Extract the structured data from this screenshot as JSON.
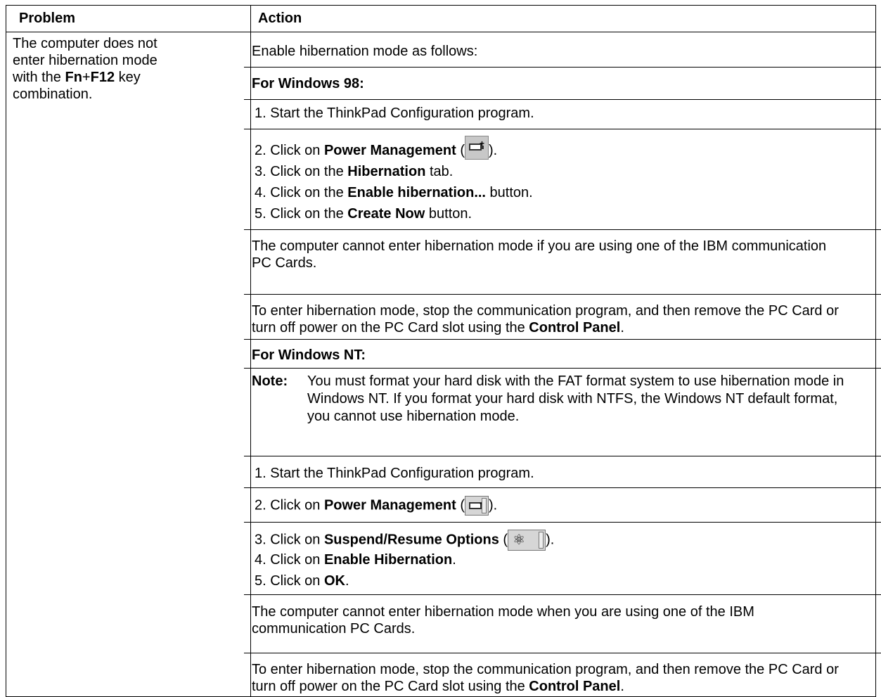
{
  "header": {
    "problem": "Problem",
    "action": "Action"
  },
  "problem": {
    "line1": "The computer does not",
    "line2": "enter hibernation mode",
    "line3_pre": "with the ",
    "key_fn": "Fn",
    "key_plus": "+",
    "key_f12": "F12",
    "line3_post": " key",
    "line4": "combination."
  },
  "action": {
    "intro": "Enable hibernation mode as follows:",
    "w98": {
      "heading": "For Windows 98:",
      "s1": "1. Start the ThinkPad Configuration program.",
      "s2_pre": "2. Click on ",
      "s2_bold": "Power Management",
      "s2_post_open": " (",
      "s2_post_close": ").",
      "s3_pre": "3. Click on the ",
      "s3_bold": "Hibernation",
      "s3_post": " tab.",
      "s4_pre": "4. Click on the ",
      "s4_bold": "Enable hibernation...",
      "s4_post": " button.",
      "s5_pre": "5. Click on the ",
      "s5_bold": "Create Now",
      "s5_post": " button.",
      "para1": "The computer cannot enter hibernation mode if you are using one of the IBM communication PC Cards.",
      "para2_pre": "To enter hibernation mode, stop the communication program, and then remove the PC Card or turn off power on the PC Card slot using the ",
      "para2_bold": "Control Panel",
      "para2_post": "."
    },
    "nt": {
      "heading": "For Windows NT:",
      "note_label": "Note:",
      "note_text": "You must format your hard disk with the FAT format system to use hibernation mode in Windows NT.  If you format your hard disk with NTFS, the Windows NT default format, you cannot use hibernation mode.",
      "s1": "1. Start the ThinkPad Configuration program.",
      "s2_pre": "2. Click on ",
      "s2_bold": "Power Management",
      "s2_post_open": " (",
      "s2_post_close": ").",
      "s3_pre": "3. Click on ",
      "s3_bold": "Suspend/Resume Options",
      "s3_post_open": " (",
      "s3_post_close": ").",
      "s4_pre": "4. Click on ",
      "s4_bold": "Enable Hibernation",
      "s4_post": ".",
      "s5_pre": "5. Click on ",
      "s5_bold": "OK",
      "s5_post": ".",
      "para1": "The computer cannot enter hibernation mode when you are using one of the IBM communication PC Cards.",
      "para2_pre": "To enter hibernation mode, stop the communication program, and then remove the PC Card or turn off power on the PC Card slot using the ",
      "para2_bold": "Control Panel",
      "para2_post": "."
    }
  },
  "icons": {
    "power_management": "battery-icon",
    "suspend_resume": "suspend-resume-icon"
  }
}
